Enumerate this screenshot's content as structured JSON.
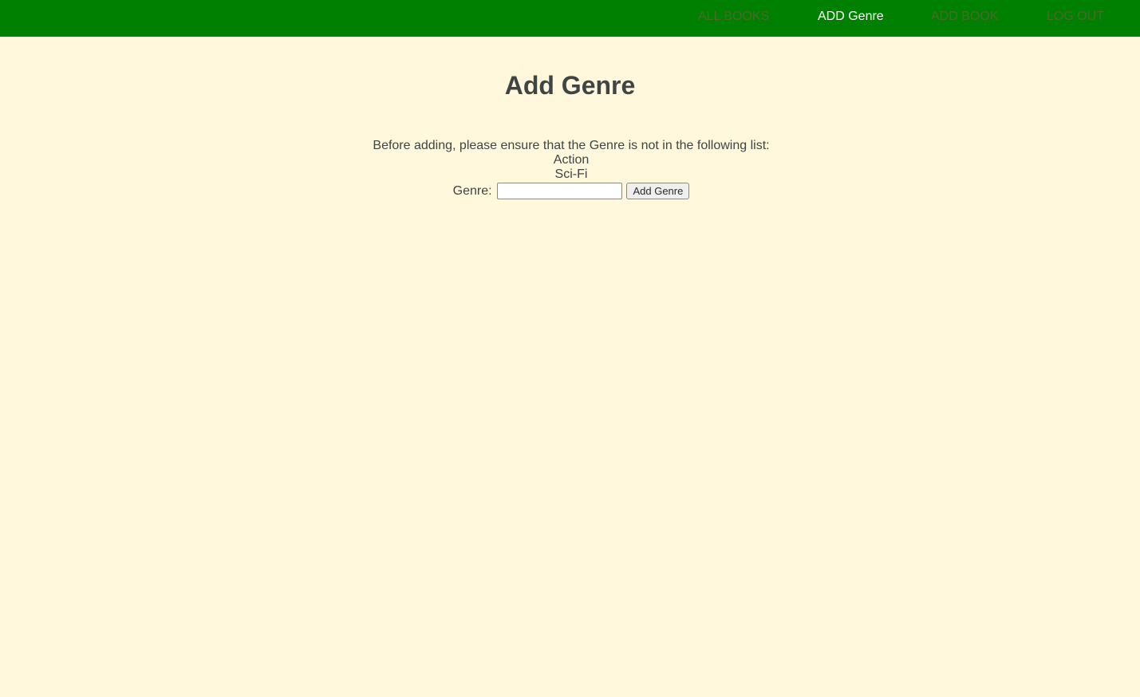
{
  "nav": {
    "items": [
      {
        "label": "ALL BOOKS"
      },
      {
        "label": "ADD Genre"
      },
      {
        "label": "ADD BOOK"
      },
      {
        "label": "LOG OUT"
      }
    ],
    "active_index": 1,
    "background_color": "#008000",
    "active_text_color": "#ffffff"
  },
  "page": {
    "title": "Add Genre",
    "background_color": "#fff8dc"
  },
  "content": {
    "instruction": "Before adding, please ensure that the Genre is not in the following list:",
    "existing_genres": [
      "Action",
      "Sci-Fi"
    ],
    "form": {
      "label": "Genre:",
      "input_value": "",
      "input_placeholder": "",
      "submit_label": "Add Genre"
    }
  }
}
